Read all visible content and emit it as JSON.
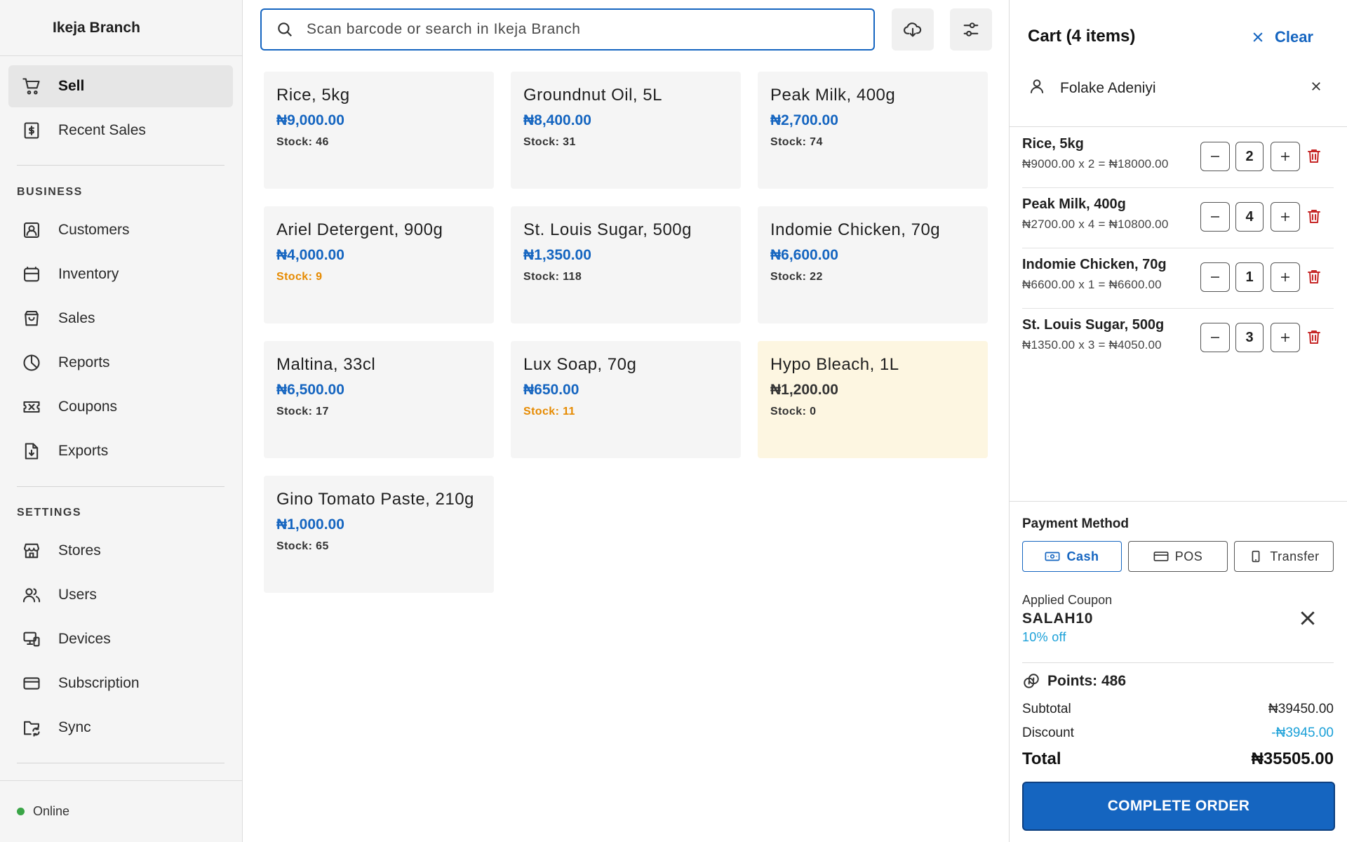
{
  "sidebar": {
    "brand": "Ikeja Branch",
    "primary": [
      {
        "label": "Sell",
        "icon": "cart-icon",
        "active": true
      },
      {
        "label": "Recent Sales",
        "icon": "receipt-icon"
      }
    ],
    "business_label": "BUSINESS",
    "business": [
      {
        "label": "Customers",
        "icon": "customer-icon"
      },
      {
        "label": "Inventory",
        "icon": "box-icon"
      },
      {
        "label": "Sales",
        "icon": "bag-icon"
      },
      {
        "label": "Reports",
        "icon": "pie-chart-icon"
      },
      {
        "label": "Coupons",
        "icon": "ticket-icon"
      },
      {
        "label": "Exports",
        "icon": "file-export-icon"
      }
    ],
    "settings_label": "SETTINGS",
    "settings": [
      {
        "label": "Stores",
        "icon": "store-icon"
      },
      {
        "label": "Users",
        "icon": "users-icon"
      },
      {
        "label": "Devices",
        "icon": "devices-icon"
      },
      {
        "label": "Subscription",
        "icon": "card-icon"
      },
      {
        "label": "Sync",
        "icon": "sync-folder-icon"
      }
    ],
    "status": "Online",
    "status_color": "#3aa547"
  },
  "search": {
    "placeholder": "Scan barcode or search in Ikeja Branch"
  },
  "products": [
    {
      "name": "Rice, 5kg",
      "price": "₦9,000.00",
      "stock": "Stock: 46",
      "low": false,
      "out": false
    },
    {
      "name": "Groundnut Oil, 5L",
      "price": "₦8,400.00",
      "stock": "Stock: 31",
      "low": false,
      "out": false
    },
    {
      "name": "Peak Milk, 400g",
      "price": "₦2,700.00",
      "stock": "Stock: 74",
      "low": false,
      "out": false
    },
    {
      "name": "Ariel Detergent, 900g",
      "price": "₦4,000.00",
      "stock": "Stock: 9",
      "low": true,
      "out": false
    },
    {
      "name": "St. Louis Sugar, 500g",
      "price": "₦1,350.00",
      "stock": "Stock: 118",
      "low": false,
      "out": false
    },
    {
      "name": "Indomie Chicken, 70g",
      "price": "₦6,600.00",
      "stock": "Stock: 22",
      "low": false,
      "out": false
    },
    {
      "name": "Maltina, 33cl",
      "price": "₦6,500.00",
      "stock": "Stock: 17",
      "low": false,
      "out": false
    },
    {
      "name": "Lux Soap, 70g",
      "price": "₦650.00",
      "stock": "Stock: 11",
      "low": true,
      "out": false
    },
    {
      "name": "Hypo Bleach, 1L",
      "price": "₦1,200.00",
      "stock": "Stock: 0",
      "low": false,
      "out": true
    },
    {
      "name": "Gino Tomato Paste, 210g",
      "price": "₦1,000.00",
      "stock": "Stock: 65",
      "low": false,
      "out": false
    }
  ],
  "cart": {
    "title": "Cart (4 items)",
    "clear_label": "Clear",
    "customer": "Folake Adeniyi",
    "items": [
      {
        "name": "Rice, 5kg",
        "calc": "₦9000.00 x 2 = ₦18000.00",
        "qty": "2"
      },
      {
        "name": "Peak Milk, 400g",
        "calc": "₦2700.00 x 4 = ₦10800.00",
        "qty": "4"
      },
      {
        "name": "Indomie Chicken, 70g",
        "calc": "₦6600.00 x 1 = ₦6600.00",
        "qty": "1"
      },
      {
        "name": "St. Louis Sugar, 500g",
        "calc": "₦1350.00 x 3 = ₦4050.00",
        "qty": "3"
      }
    ],
    "payment_label": "Payment Method",
    "payment_methods": [
      {
        "label": "Cash",
        "icon": "cash-icon",
        "active": true
      },
      {
        "label": "POS",
        "icon": "card-icon",
        "active": false
      },
      {
        "label": "Transfer",
        "icon": "phone-icon",
        "active": false
      }
    ],
    "coupon": {
      "label": "Applied Coupon",
      "code": "SALAH10",
      "off": "10% off"
    },
    "points": "Points: 486",
    "subtotal_label": "Subtotal",
    "subtotal": "₦39450.00",
    "discount_label": "Discount",
    "discount": "-₦3945.00",
    "total_label": "Total",
    "total": "₦35505.00",
    "complete_label": "COMPLETE ORDER"
  },
  "colors": {
    "accent": "#1565c0",
    "low_stock": "#e68a00",
    "out_of_stock_bg": "#fdf6e1",
    "danger": "#c62828",
    "discount": "#1aa0d8"
  }
}
